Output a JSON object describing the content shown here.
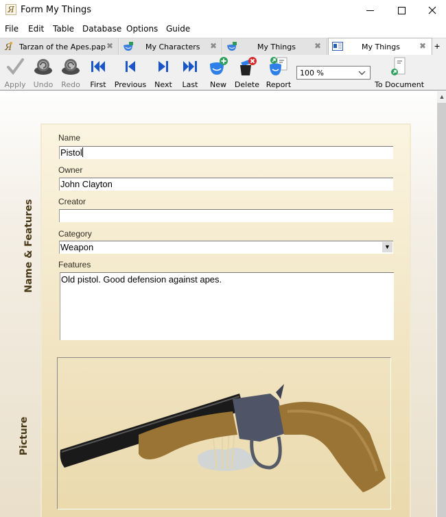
{
  "window": {
    "title": "Form My Things",
    "controls": {
      "minimize": "minimize",
      "maximize": "maximize",
      "close": "close"
    }
  },
  "menu": [
    "File",
    "Edit",
    "Table",
    "Database",
    "Options",
    "Guide"
  ],
  "tabs": [
    {
      "label": "Tarzan of the Apes.pap",
      "icon": "app-logo-icon",
      "active": false
    },
    {
      "label": "My Characters",
      "icon": "mask-table-icon",
      "active": false
    },
    {
      "label": "My Things",
      "icon": "mask-table-icon",
      "active": false
    },
    {
      "label": "My Things",
      "icon": "form-icon",
      "active": true
    }
  ],
  "tab_add": "+",
  "tab_close_glyph": "✖",
  "toolbar": {
    "apply": "Apply",
    "undo": "Undo",
    "redo": "Redo",
    "first": "First",
    "previous": "Previous",
    "next": "Next",
    "last": "Last",
    "new": "New",
    "delete": "Delete",
    "report": "Report",
    "zoom_value": "100 %",
    "to_document": "To Document"
  },
  "sections": {
    "name_features": "Name & Features",
    "picture": "Picture"
  },
  "form": {
    "name": {
      "label": "Name",
      "value": "Pistol"
    },
    "owner": {
      "label": "Owner",
      "value": "John Clayton"
    },
    "creator": {
      "label": "Creator",
      "value": ""
    },
    "category": {
      "label": "Category",
      "value": "Weapon"
    },
    "features": {
      "label": "Features",
      "value": "Old pistol. Good defension against apes."
    }
  },
  "picture": {
    "description": "antique single-shot pistol with wooden grip"
  },
  "colors": {
    "nav_blue": "#1a56c8",
    "section_text": "#4a3a18",
    "panel_top": "#fbf4e0",
    "panel_bottom": "#ead9ac"
  }
}
